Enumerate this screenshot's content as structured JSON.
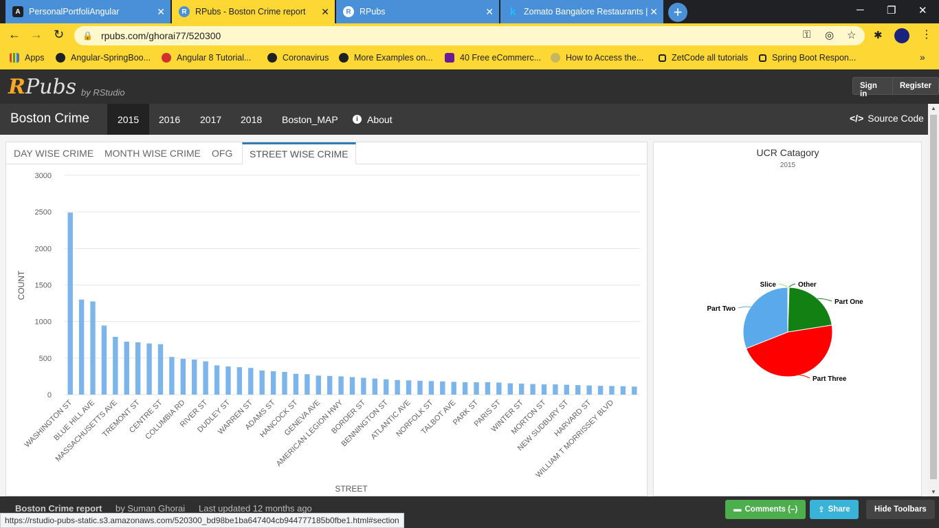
{
  "browser": {
    "tabs": [
      {
        "title": "PersonalPortfoliAngular",
        "icon": "A"
      },
      {
        "title": "RPubs - Boston Crime report",
        "icon": "R"
      },
      {
        "title": "RPubs",
        "icon": "R"
      },
      {
        "title": "Zomato Bangalore Restaurants |",
        "icon": "k"
      }
    ],
    "url": "rpubs.com/ghorai77/520300",
    "bookmarks": [
      "Apps",
      "Angular-SpringBoo...",
      "Angular 8 Tutorial...",
      "Coronavirus",
      "More Examples on...",
      "40 Free eCommerc...",
      "How to Access the...",
      "ZetCode all tutorials",
      "Spring Boot Respon..."
    ],
    "status_url": "https://rstudio-pubs-static.s3.amazonaws.com/520300_bd98be1ba647404cb944777185b0fbe1.html#section"
  },
  "rpubs": {
    "logo_r": "R",
    "logo_rest": "Pubs",
    "byline": "by RStudio",
    "sign_in": "Sign in",
    "register": "Register"
  },
  "dashboard": {
    "title": "Boston Crime",
    "nav": [
      "2015",
      "2016",
      "2017",
      "2018",
      "Boston_MAP",
      "About"
    ],
    "source_code": "Source Code",
    "tabs": [
      "DAY WISE CRIME",
      "MONTH WISE CRIME",
      "OFG",
      "STREET WISE CRIME"
    ]
  },
  "chart_data": [
    {
      "type": "bar",
      "title": "",
      "xlabel": "STREET",
      "ylabel": "COUNT",
      "ylim": [
        0,
        3000
      ],
      "yticks": [
        "0",
        "500",
        "1000",
        "1500",
        "2000",
        "2500",
        "3000"
      ],
      "bar_color": "#7cb5ec",
      "categories": [
        "WASHINGTON ST",
        "",
        "BLUE HILL AVE",
        "",
        "MASSACHUSETTS AVE",
        "",
        "TREMONT ST",
        "",
        "CENTRE ST",
        "",
        "COLUMBIA RD",
        "",
        "RIVER ST",
        "",
        "DUDLEY ST",
        "",
        "WARREN ST",
        "",
        "ADAMS ST",
        "",
        "HANCOCK ST",
        "",
        "GENEVA AVE",
        "",
        "AMERICAN LEGION HWY",
        "",
        "BORDER ST",
        "",
        "BENNINGTON ST",
        "",
        "ATLANTIC AVE",
        "",
        "NORFOLK ST",
        "",
        "TALBOT AVE",
        "",
        "PARK ST",
        "",
        "PARIS ST",
        "",
        "WINTER ST",
        "",
        "MORTON ST",
        "",
        "NEW SUDBURY ST",
        "",
        "HARVARD ST",
        "",
        "WILLIAM T MORRISSEY BLVD",
        ""
      ],
      "values": [
        2490,
        1300,
        1275,
        945,
        790,
        725,
        715,
        700,
        690,
        515,
        490,
        480,
        455,
        400,
        385,
        375,
        365,
        330,
        320,
        310,
        285,
        280,
        260,
        255,
        250,
        240,
        230,
        220,
        210,
        200,
        195,
        190,
        185,
        180,
        175,
        170,
        170,
        170,
        165,
        155,
        150,
        145,
        140,
        140,
        135,
        130,
        125,
        120,
        118,
        115,
        110
      ]
    },
    {
      "type": "pie",
      "title": "UCR Catagory",
      "subtitle": "2015",
      "slices": [
        {
          "name": "Slice",
          "value": 0.2,
          "color": "#90ed7d"
        },
        {
          "name": "Other",
          "value": 0.3,
          "color": "#0a7d0a"
        },
        {
          "name": "Part One",
          "value": 22.0,
          "color": "#138013"
        },
        {
          "name": "Part Three",
          "value": 46.5,
          "color": "#ff0000"
        },
        {
          "name": "Part Two",
          "value": 31.0,
          "color": "#5aa9ea"
        }
      ]
    }
  ],
  "footer": {
    "report": "Boston Crime report",
    "author": "by Suman Ghorai",
    "updated": "Last updated 12 months ago",
    "comments": "Comments (–)",
    "share": "Share",
    "hide": "Hide Toolbars"
  }
}
